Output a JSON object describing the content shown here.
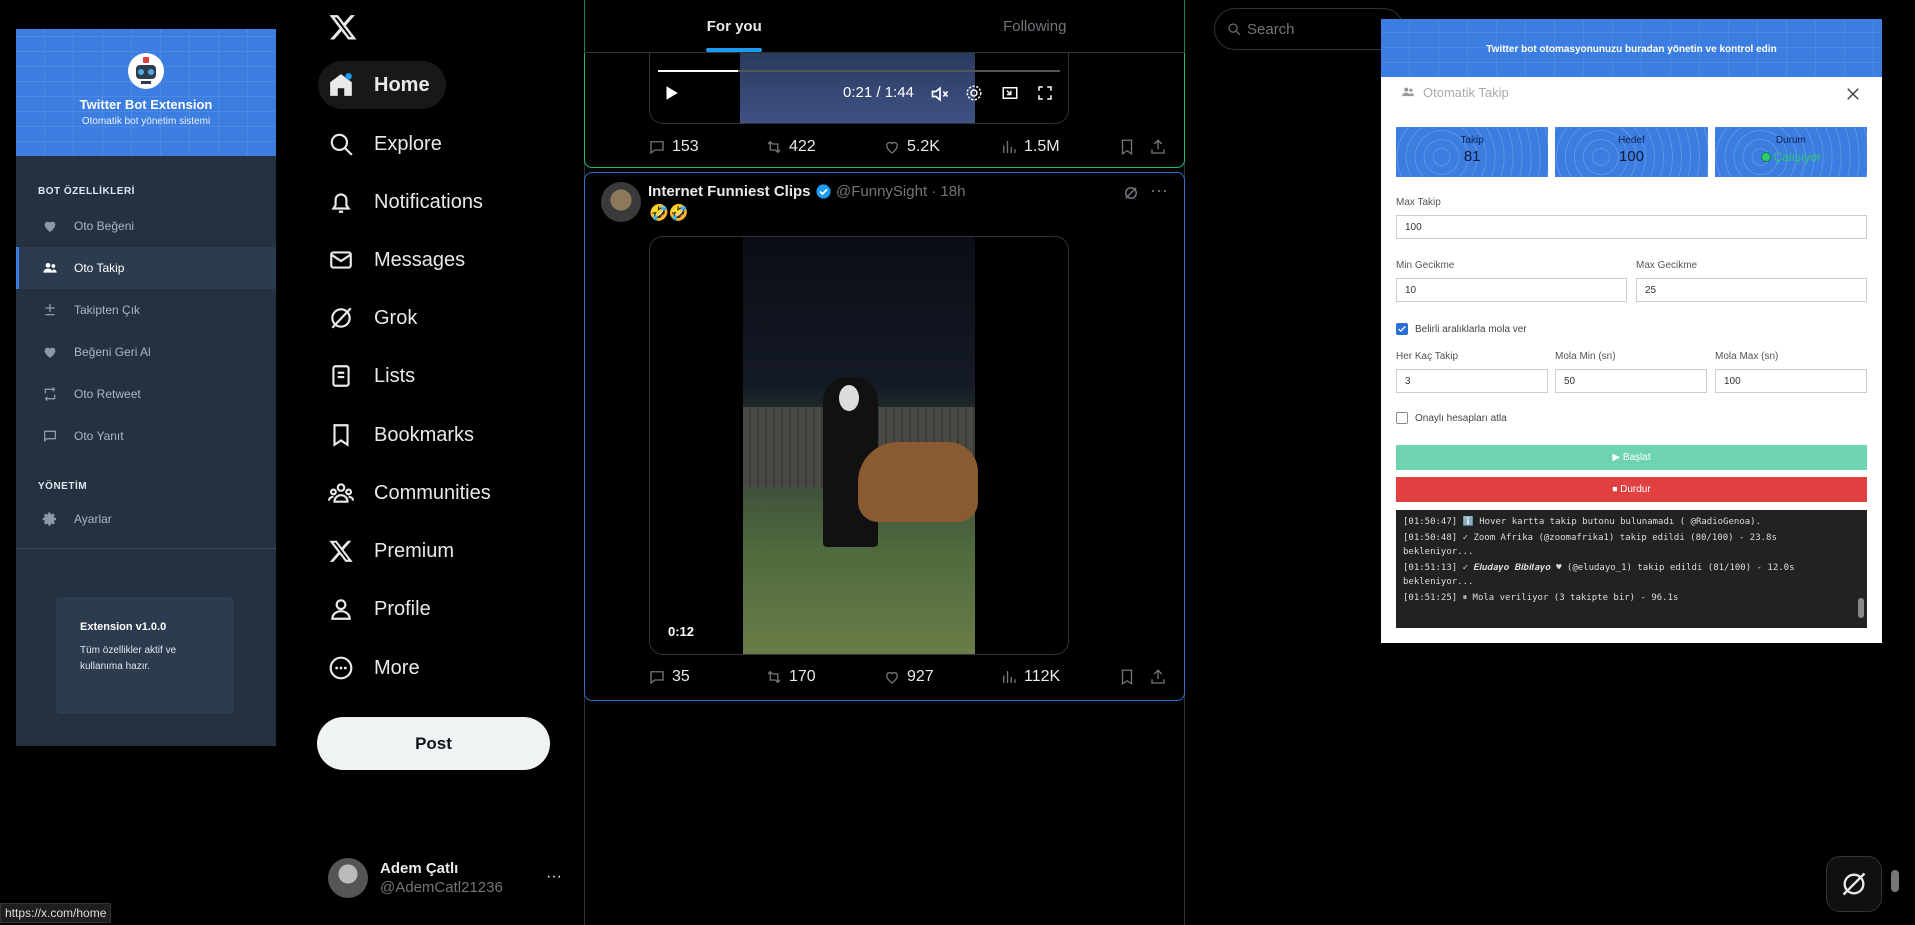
{
  "extension": {
    "title": "Twitter Bot Extension",
    "subtitle": "Otomatik bot yönetim sistemi",
    "section_features": "BOT ÖZELLİKLERİ",
    "features": [
      {
        "label": "Oto Beğeni",
        "icon": "heart-icon"
      },
      {
        "label": "Oto Takip",
        "icon": "users-icon",
        "active": true
      },
      {
        "label": "Takipten Çık",
        "icon": "plus-minus-icon"
      },
      {
        "label": "Beğeni Geri Al",
        "icon": "heart-icon"
      },
      {
        "label": "Oto Retweet",
        "icon": "retweet-icon"
      },
      {
        "label": "Oto Yanıt",
        "icon": "comment-icon"
      }
    ],
    "section_management": "YÖNETİM",
    "settings_label": "Ayarlar",
    "version_title": "Extension v1.0.0",
    "version_desc": "Tüm özellikler aktif ve kullanıma hazır.",
    "accent_color": "#3b7de0"
  },
  "nav": {
    "items": [
      {
        "label": "Home",
        "icon": "home-icon"
      },
      {
        "label": "Explore",
        "icon": "search-icon"
      },
      {
        "label": "Notifications",
        "icon": "bell-icon"
      },
      {
        "label": "Messages",
        "icon": "mail-icon"
      },
      {
        "label": "Grok",
        "icon": "grok-icon"
      },
      {
        "label": "Lists",
        "icon": "list-icon"
      },
      {
        "label": "Bookmarks",
        "icon": "bookmark-icon"
      },
      {
        "label": "Communities",
        "icon": "communities-icon"
      },
      {
        "label": "Premium",
        "icon": "x-icon"
      },
      {
        "label": "Profile",
        "icon": "profile-icon"
      },
      {
        "label": "More",
        "icon": "more-circle-icon"
      }
    ],
    "post_label": "Post",
    "account_name": "Adem Çatlı",
    "account_handle": "@AdemCatl21236",
    "status_url": "https://x.com/home"
  },
  "timeline": {
    "tabs": [
      "For you",
      "Following"
    ],
    "tweet1": {
      "video_time": "0:21 / 1:44",
      "video_progress": 0.2,
      "replies": "153",
      "retweets": "422",
      "likes": "5.2K",
      "views": "1.5M"
    },
    "tweet2": {
      "name": "Internet Funniest Clips",
      "handle": "@FunnySight · 18h",
      "text": "🤣🤣",
      "video_time": "0:12",
      "replies": "35",
      "retweets": "170",
      "likes": "927",
      "views": "112K"
    }
  },
  "search": {
    "placeholder": "Search"
  },
  "panel": {
    "banner": "Twitter bot otomasyonunuzu buradan yönetin ve kontrol edin",
    "title": "Otomatik Takip",
    "stats": [
      {
        "label": "Takip",
        "value": "81"
      },
      {
        "label": "Hedef",
        "value": "100"
      },
      {
        "label": "Durum",
        "value": "Çalışıyor"
      }
    ],
    "max_takip_label": "Max Takip",
    "max_takip_value": "100",
    "min_gecikme_label": "Min Gecikme",
    "min_gecikme_value": "10",
    "max_gecikme_label": "Max Gecikme",
    "max_gecikme_value": "25",
    "mola_check_label": "Belirli aralıklarla mola ver",
    "mola_check_on": true,
    "her_kac_label": "Her Kaç Takip",
    "her_kac_value": "3",
    "mola_min_label": "Mola Min (sn)",
    "mola_min_value": "50",
    "mola_max_label": "Mola Max (sn)",
    "mola_max_value": "100",
    "verified_check_label": "Onaylı hesapları atla",
    "verified_check_on": false,
    "start_label": "▶ Başlat",
    "stop_label": "⏹ Durdur",
    "logs": [
      "[01:50:47] ℹ️ Hover kartta takip butonu bulunamadı ( @RadioGenoa).",
      "[01:50:48] ✓ Zoom Afrika (@zoomafrika1) takip edildi (80/100) - 23.8s bekleniyor...",
      "[01:51:13] ✓ 𝑬𝒍𝒖𝒅𝒂𝒚𝒐 𝑩𝒊𝒃𝒊𝒕𝒂𝒚𝒐 ♥ (@eludayo_1) takip edildi (81/100) - 12.0s bekleniyor...",
      "[01:51:25] ⏸ Mola veriliyor (3 takipte bir) - 96.1s"
    ]
  }
}
